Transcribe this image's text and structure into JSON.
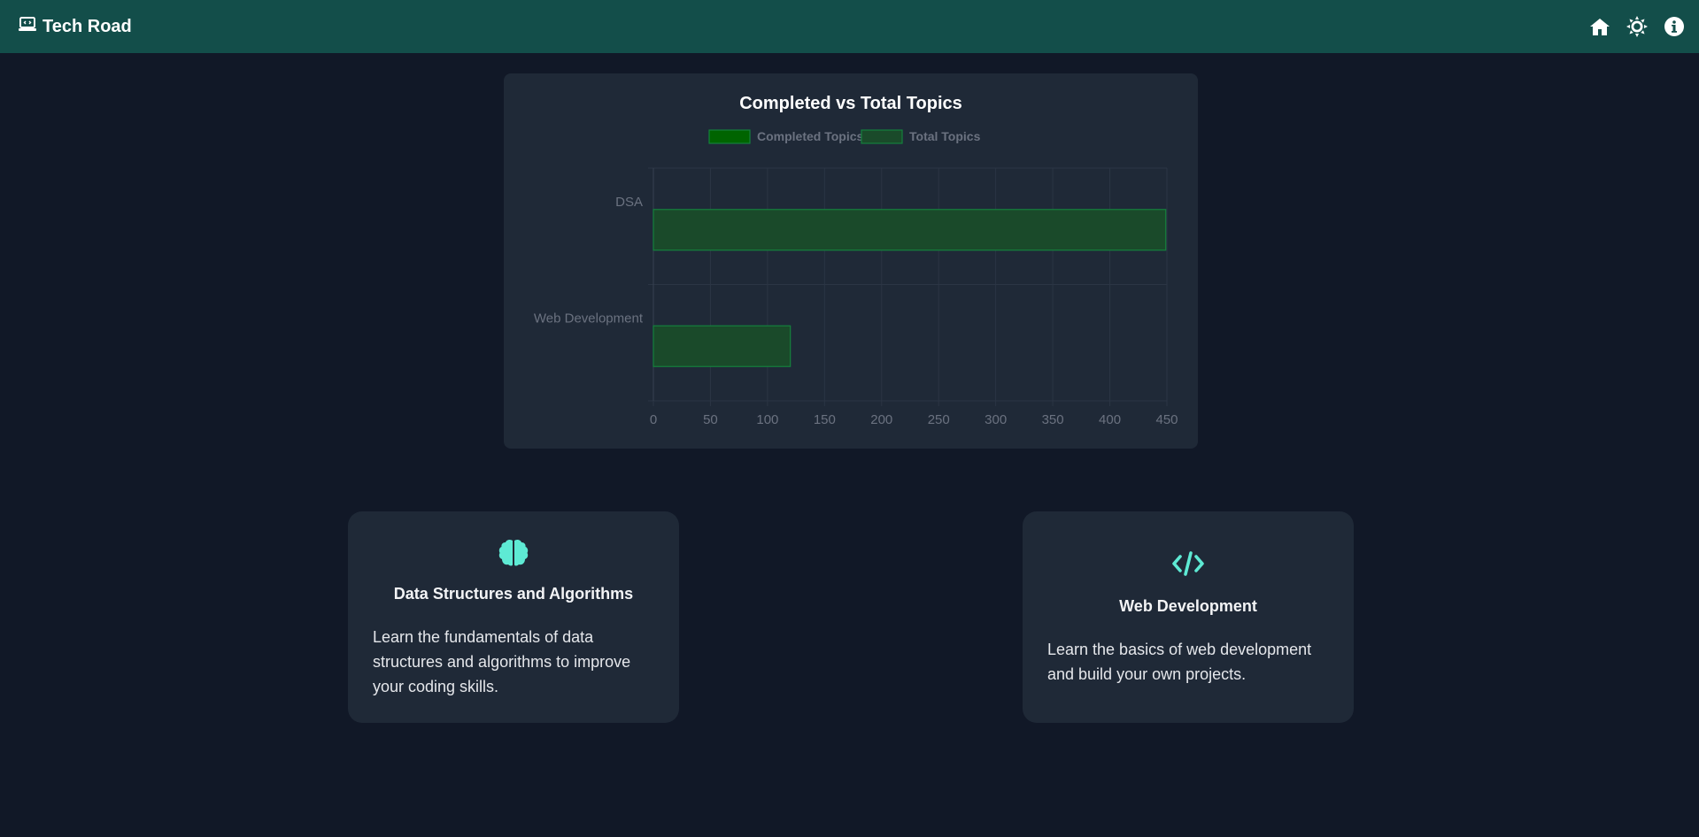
{
  "navbar": {
    "brand": "Tech Road",
    "icons": [
      "laptop-code-icon",
      "home-icon",
      "sun-icon",
      "info-icon"
    ],
    "background": "#134e4a"
  },
  "chart": {
    "title": "Completed vs Total Topics",
    "legend": [
      "Completed Topics",
      "Total Topics"
    ]
  },
  "chart_data": {
    "type": "bar",
    "orientation": "horizontal",
    "title": "Completed vs Total Topics",
    "categories": [
      "DSA",
      "Web Development"
    ],
    "series": [
      {
        "name": "Completed Topics",
        "values": [
          0,
          0
        ],
        "color": "#006400"
      },
      {
        "name": "Total Topics",
        "values": [
          449,
          120
        ],
        "color": "#1a4a2a"
      }
    ],
    "xlim": [
      0,
      450
    ],
    "xticks": [
      0,
      50,
      100,
      150,
      200,
      250,
      300,
      350,
      400,
      450
    ],
    "grid": true,
    "legend_position": "top"
  },
  "cards": [
    {
      "icon": "brain-icon",
      "title": "Data Structures and Algorithms",
      "description": "Learn the fundamentals of data structures and algorithms to improve your coding skills."
    },
    {
      "icon": "code-icon",
      "title": "Web Development",
      "description": "Learn the basics of web development and build your own projects."
    }
  ],
  "accent": "#5eead4"
}
